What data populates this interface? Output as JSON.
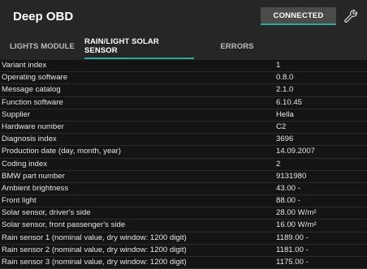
{
  "app": {
    "title": "Deep OBD",
    "connect_label": "CONNECTED",
    "accent_color": "#2ea89b",
    "settings_icon": "wrench-icon"
  },
  "tabs": [
    {
      "label": "LIGHTS MODULE",
      "active": false
    },
    {
      "label": "RAIN/LIGHT SOLAR SENSOR",
      "active": true
    },
    {
      "label": "ERRORS",
      "active": false
    }
  ],
  "rows": [
    {
      "label": "Variant index",
      "value": "1"
    },
    {
      "label": "Operating software",
      "value": "0.8.0"
    },
    {
      "label": "Message catalog",
      "value": "2.1.0"
    },
    {
      "label": "Function software",
      "value": "6.10.45"
    },
    {
      "label": "Supplier",
      "value": "Hella"
    },
    {
      "label": "Hardware number",
      "value": "C2"
    },
    {
      "label": "Diagnosis index",
      "value": "3696"
    },
    {
      "label": "Production date (day, month, year)",
      "value": "14.09.2007"
    },
    {
      "label": "Coding index",
      "value": "2"
    },
    {
      "label": "BMW part number",
      "value": "9131980"
    },
    {
      "label": "Ambient brightness",
      "value": "43.00 -"
    },
    {
      "label": "Front light",
      "value": "88.00 -"
    },
    {
      "label": "Solar sensor, driver's side",
      "value": "28.00 W/m²"
    },
    {
      "label": "Solar sensor, front passenger's side",
      "value": "16.00 W/m²"
    },
    {
      "label": "Rain sensor 1 (nominal value, dry window: 1200 digit)",
      "value": "1189.00 -"
    },
    {
      "label": "Rain sensor 2 (nominal value, dry window: 1200 digit)",
      "value": "1181.00 -"
    },
    {
      "label": "Rain sensor 3 (nominal value, dry window: 1200 digit)",
      "value": "1175.00 -"
    }
  ]
}
